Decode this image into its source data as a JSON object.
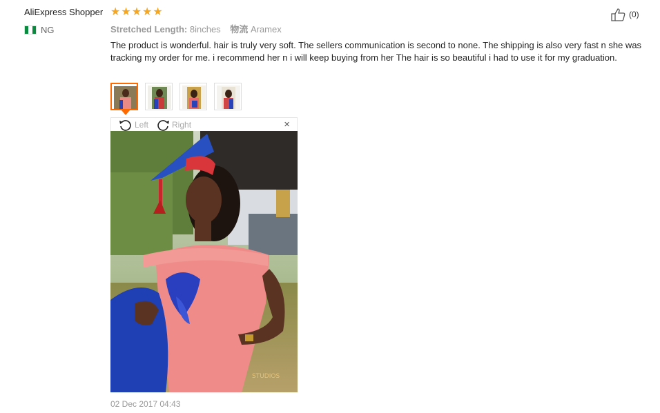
{
  "review": {
    "user_name": "AliExpress Shopper",
    "rating_stars": 5,
    "country_code": "NG",
    "attributes": [
      {
        "key": "Stretched Length:",
        "value": "8inches"
      },
      {
        "key": "物流",
        "value": "Aramex"
      }
    ],
    "text": "The product is wonderful. hair is truly very soft. The sellers communication is second to none. The shipping is also very fast n she was tracking my order for me. i recommend her n i will keep buying from her The hair is so beautiful i had to use it for my graduation.",
    "helpful_count": "(0)",
    "date": "02 Dec 2017 04:43"
  },
  "viewer": {
    "rotate_left_label": "Left",
    "rotate_right_label": "Right",
    "close_symbol": "×"
  },
  "thumbnails": [
    "photo-1",
    "photo-2",
    "photo-3",
    "photo-4"
  ],
  "icons": {
    "star": "star-icon",
    "thumb_up": "thumbs-up-icon",
    "rotate_left": "rotate-left-icon",
    "rotate_right": "rotate-right-icon"
  },
  "colors": {
    "star": "#f5a623",
    "accent": "#ff6a00",
    "flag_green": "#0a8a3e"
  },
  "photo_watermark": "STUDIOS"
}
